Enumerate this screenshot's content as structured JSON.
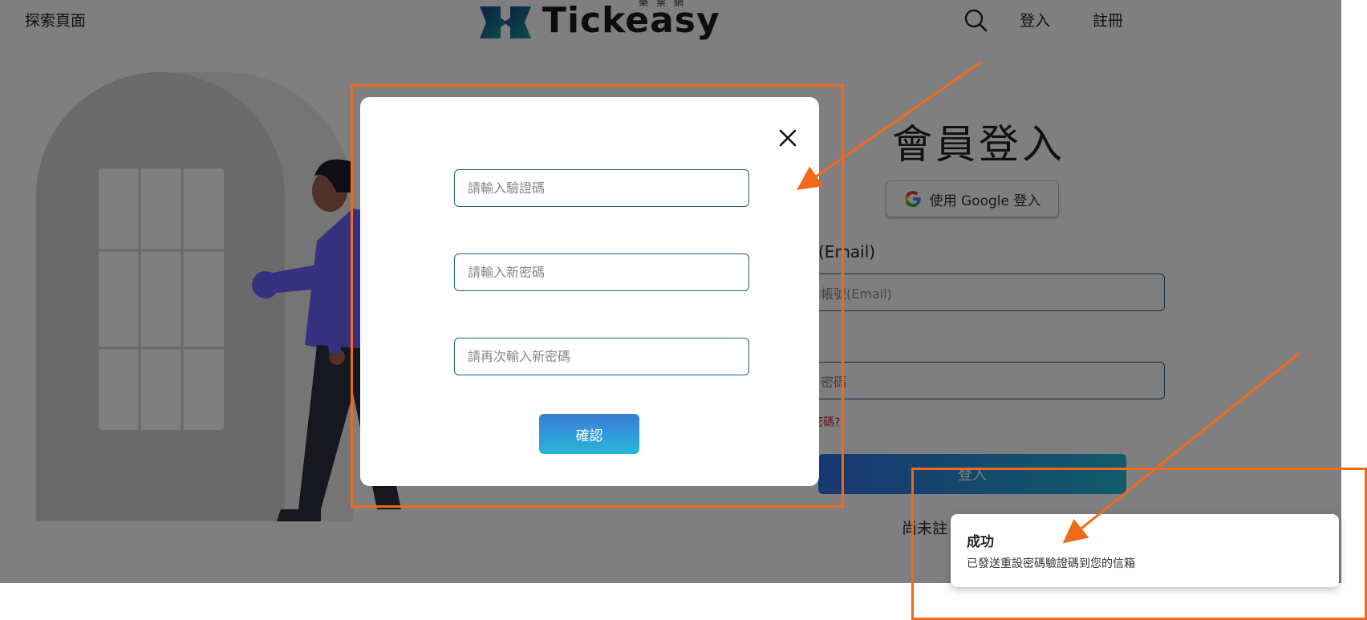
{
  "header": {
    "explore_label": "探索頁面",
    "logo_text": "Tickeasy",
    "logo_subtitle": "樂票網",
    "login_label": "登入",
    "register_label": "註冊"
  },
  "login_page": {
    "title": "會員登入",
    "google_button_label": "使用 Google 登入",
    "email_label": "(Email)",
    "email_placeholder": "帳號(Email)",
    "password_placeholder": "密碼",
    "forgot_link": "密碼?",
    "submit_label": "登入",
    "no_account_text": "尚未註"
  },
  "modal": {
    "code_placeholder": "請輸入驗證碼",
    "new_password_placeholder": "請輸入新密碼",
    "confirm_password_placeholder": "請再次輸入新密碼",
    "confirm_button_label": "確認"
  },
  "toast": {
    "title": "成功",
    "message": "已發送重設密碼驗證碼到您的信箱"
  },
  "colors": {
    "accent_gradient_start": "#3a7bd8",
    "accent_gradient_end": "#27b8d8",
    "annotation": "#f06a1a",
    "input_border": "#1f5f8a",
    "error_text": "#c0282b"
  }
}
